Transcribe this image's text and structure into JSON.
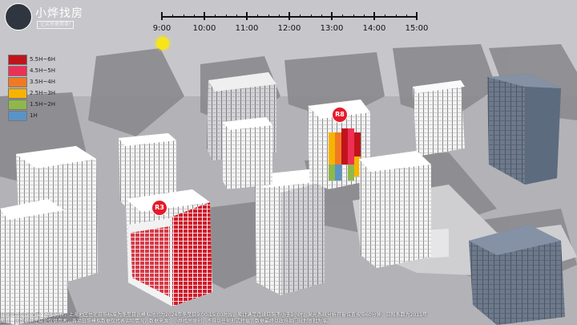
{
  "brand": {
    "name": "小烨找房",
    "subtitle": "让买房更简单!"
  },
  "timeline": {
    "labels": [
      "9:00",
      "10:00",
      "11:00",
      "12:00",
      "13:00",
      "14:00",
      "15:00"
    ]
  },
  "legend": [
    {
      "label": "5.5H~6H",
      "color": "#c0141c"
    },
    {
      "label": "4.5H~5H",
      "color": "#ef2f55"
    },
    {
      "label": "3.5H~4H",
      "color": "#f07a23"
    },
    {
      "label": "2.5H~3H",
      "color": "#f6b400"
    },
    {
      "label": "1.5H~2H",
      "color": "#8fb84a"
    },
    {
      "label": "1H",
      "color": "#5a93c6"
    }
  ],
  "buildings": {
    "r3": "R3",
    "r8": "R8"
  },
  "footer": {
    "line1": "日照计算参数:范围：模拟分析，上海地区住宅日照标准为冬至日，模拟时间为2024年冬至日9:00-15:00时段，累计满足连续日照不小于1小时；采光系统分析开窗位置按照60分钟，日照系数为2011年",
    "line2": "图示：该数据标注结论仅供参考，各项日照模拟数据仅代表实际情况，数据来源：小烨找房原创，不得以任何形式转载，数据最终以政府部门规划审批为准。"
  }
}
